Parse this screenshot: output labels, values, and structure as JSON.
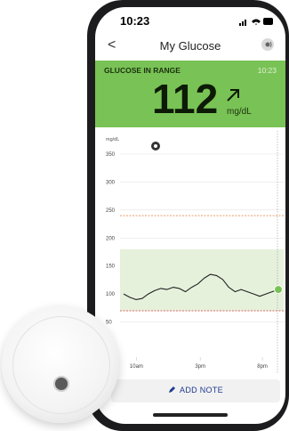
{
  "status_bar": {
    "time": "10:23"
  },
  "nav": {
    "back": "<",
    "title": "My Glucose"
  },
  "banner": {
    "label": "GLUCOSE IN RANGE",
    "time": "10:23",
    "value": "112",
    "units": "mg/dL",
    "color": "#79c255"
  },
  "chart_data": {
    "type": "line",
    "ylabel": "mg/dL",
    "y_ticks": [
      350,
      300,
      250,
      200,
      150,
      100,
      50
    ],
    "x_ticks": [
      "10am",
      "3pm",
      "8pm"
    ],
    "ylim": [
      0,
      350
    ],
    "target_range": [
      70,
      180
    ],
    "high_line": 240,
    "low_line": 70,
    "series": [
      {
        "values": [
          100,
          94,
          90,
          92,
          100,
          106,
          110,
          108,
          112,
          110,
          104,
          112,
          118,
          128,
          135,
          133,
          126,
          112,
          104,
          108,
          104,
          100,
          96,
          100,
          104,
          108
        ]
      }
    ],
    "current_value": 108,
    "colors": {
      "line": "#222222",
      "range": "#e6f1dc",
      "high": "#e07b39",
      "low": "#d23b3b",
      "point": "#79c255"
    }
  },
  "note": {
    "label": "ADD NOTE"
  }
}
